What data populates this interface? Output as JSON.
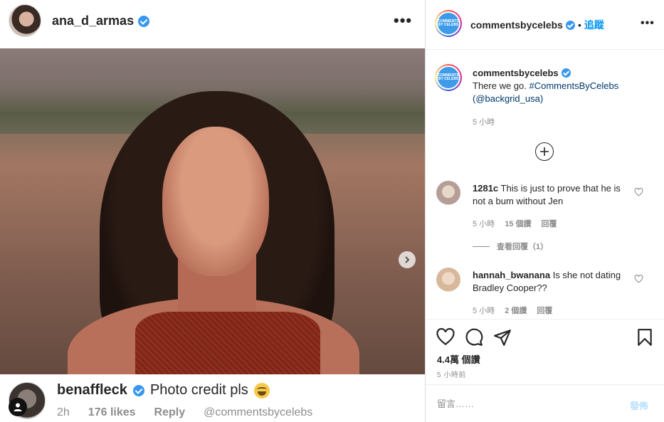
{
  "left_post": {
    "username": "ana_d_armas",
    "verified": true,
    "more_icon": "more-horizontal-icon",
    "next_icon": "chevron-right-icon"
  },
  "bottom_comment": {
    "username": "benaffleck",
    "text": "Photo credit pls",
    "emoji": "laughing-tears-emoji",
    "time": "2h",
    "likes": "176 likes",
    "reply": "Reply",
    "credit": "@commentsbycelebs"
  },
  "panel": {
    "header": {
      "username": "commentsbycelebs",
      "dot": "•",
      "follow": "追蹤",
      "avatar_text": "COMMENTS BY CELEBS"
    },
    "caption": {
      "username": "commentsbycelebs",
      "text_plain": "There we go. ",
      "hashtag": "#CommentsByCelebs",
      "mention": "(@backgrid_usa)",
      "time": "5 小時"
    },
    "comments": [
      {
        "username": "1281c",
        "text": "This is just to prove that he is not a bum without Jen",
        "time": "5 小時",
        "likes": "15 個讚",
        "reply": "回覆",
        "view_replies": "查看回覆（1）"
      },
      {
        "username": "hannah_bwanana",
        "text": "Is she not dating Bradley Cooper??",
        "time": "5 小時",
        "likes": "2 個讚",
        "reply": "回覆"
      }
    ],
    "views": "4.4萬 個讚",
    "posted": "5 小時前",
    "add_comment_placeholder": "留言……",
    "post_button": "發佈"
  },
  "colors": {
    "link": "#00376b",
    "follow": "#0095f6",
    "verified": "#3897f0",
    "post_disabled": "#b2dffc",
    "meta": "#8e8e8e"
  }
}
